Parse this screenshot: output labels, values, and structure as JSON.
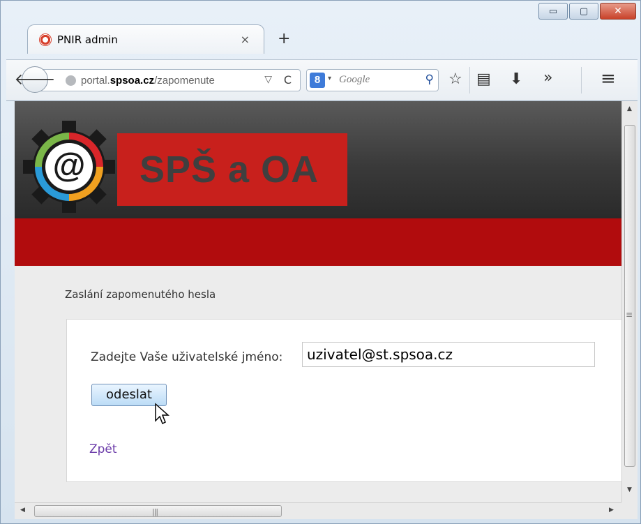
{
  "window": {
    "minimize_glyph": "▭",
    "maximize_glyph": "▢",
    "close_glyph": "✕"
  },
  "tab": {
    "title": "PNIR admin",
    "close_glyph": "×",
    "new_tab_glyph": "+"
  },
  "toolbar": {
    "back_glyph": "🡐",
    "url_prefix": "portal.",
    "url_domain": "spsoa.cz",
    "url_path": "/zapomenute",
    "dropdown_glyph": "▽",
    "reload_glyph": "C",
    "search_engine": "8",
    "search_placeholder": "Google",
    "search_glyph": "⚲",
    "bookmark_glyph": "☆",
    "reader_glyph": "▤",
    "download_glyph": "⬇",
    "overflow_glyph": "»",
    "menu_glyph": "≡"
  },
  "page": {
    "logo_text": "SPŠ a OA",
    "logo_symbol": "@",
    "section_title": "Zaslání zapomenutého hesla",
    "field_label": "Zadejte Vaše uživatelské jméno:",
    "username_value": "uzivatel@st.spsoa.cz",
    "submit_label": "odeslat",
    "back_link": "Zpět"
  },
  "scrollbars": {
    "up_arrow": "▲",
    "down_arrow": "▼",
    "left_arrow": "◀",
    "right_arrow": "▶",
    "v_grip": "≡",
    "h_grip": "|||"
  },
  "colors": {
    "header_red": "#b10c0d",
    "logo_red": "#c8201c",
    "link_purple": "#6a3aa8",
    "button_blue": "#bcdcf6"
  }
}
